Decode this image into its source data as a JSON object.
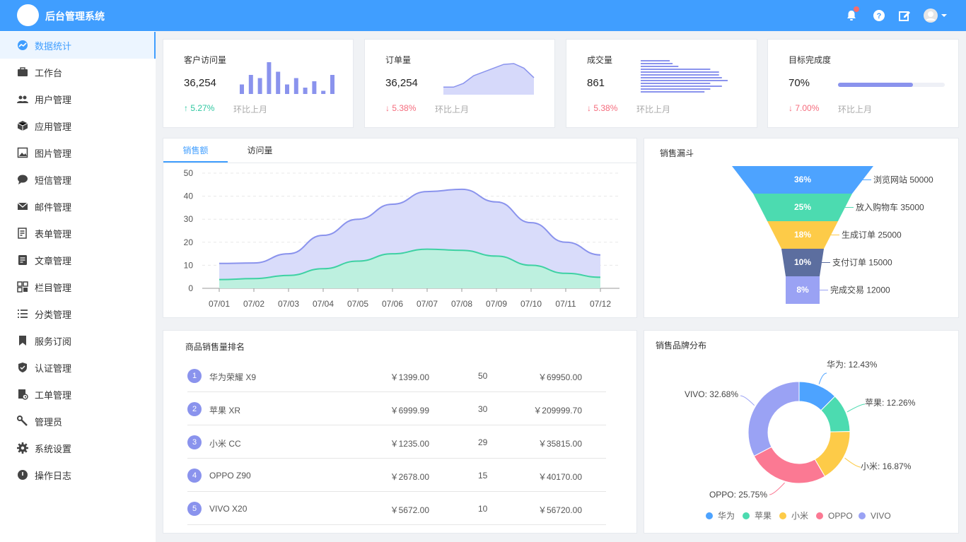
{
  "header": {
    "title": "后台管理系统"
  },
  "sidebar": {
    "items": [
      {
        "label": "数据统计",
        "icon": "dashboard-icon",
        "active": true
      },
      {
        "label": "工作台",
        "icon": "briefcase-icon"
      },
      {
        "label": "用户管理",
        "icon": "users-icon"
      },
      {
        "label": "应用管理",
        "icon": "cube-icon"
      },
      {
        "label": "图片管理",
        "icon": "image-icon"
      },
      {
        "label": "短信管理",
        "icon": "chat-icon"
      },
      {
        "label": "邮件管理",
        "icon": "mail-icon"
      },
      {
        "label": "表单管理",
        "icon": "form-icon"
      },
      {
        "label": "文章管理",
        "icon": "article-icon"
      },
      {
        "label": "栏目管理",
        "icon": "grid-icon"
      },
      {
        "label": "分类管理",
        "icon": "list-icon"
      },
      {
        "label": "服务订阅",
        "icon": "bookmark-icon"
      },
      {
        "label": "认证管理",
        "icon": "shield-icon"
      },
      {
        "label": "工单管理",
        "icon": "ticket-icon"
      },
      {
        "label": "管理员",
        "icon": "wrench-icon"
      },
      {
        "label": "系统设置",
        "icon": "gear-icon"
      },
      {
        "label": "操作日志",
        "icon": "log-icon"
      }
    ]
  },
  "kpis": [
    {
      "label": "客户访问量",
      "value": "36,254",
      "trend": "↑ 5.27%",
      "dir": "up",
      "compare": "环比上月"
    },
    {
      "label": "订单量",
      "value": "36,254",
      "trend": "↓ 5.38%",
      "dir": "down",
      "compare": "环比上月"
    },
    {
      "label": "成交量",
      "value": "861",
      "trend": "↓ 5.38%",
      "dir": "down",
      "compare": "环比上月"
    },
    {
      "label": "目标完成度",
      "value": "70%",
      "trend": "↓ 7.00%",
      "dir": "down",
      "compare": "环比上月",
      "progress": 0.7
    }
  ],
  "sales_tabs": [
    "销售额",
    "访问量"
  ],
  "funnel_title": "销售漏斗",
  "ranking": {
    "title": "商品销售量排名",
    "rows": [
      {
        "rank": "1",
        "name": "华为荣耀 X9",
        "price": "￥1399.00",
        "qty": "50",
        "total": "￥69950.00"
      },
      {
        "rank": "2",
        "name": "苹果 XR",
        "price": "￥6999.99",
        "qty": "30",
        "total": "￥209999.70"
      },
      {
        "rank": "3",
        "name": "小米 CC",
        "price": "￥1235.00",
        "qty": "29",
        "total": "￥35815.00"
      },
      {
        "rank": "4",
        "name": "OPPO Z90",
        "price": "￥2678.00",
        "qty": "15",
        "total": "￥40170.00"
      },
      {
        "rank": "5",
        "name": "VIVO X20",
        "price": "￥5672.00",
        "qty": "10",
        "total": "￥56720.00"
      }
    ]
  },
  "brand_title": "销售品牌分布",
  "chart_data": [
    {
      "type": "bar",
      "name": "visits-sparkline",
      "values": [
        3,
        6,
        5,
        10,
        7,
        3,
        5,
        2,
        4,
        1,
        6
      ]
    },
    {
      "type": "area",
      "name": "orders-sparkline",
      "values": [
        2,
        2,
        3,
        5,
        6,
        7,
        8,
        8.2,
        7,
        4.5
      ]
    },
    {
      "type": "bar",
      "name": "deals-sparkline",
      "orientation": "horizontal",
      "values": [
        5,
        5.5,
        6.5,
        12,
        13.5,
        13.5,
        14,
        15,
        12,
        14,
        12,
        11
      ]
    },
    {
      "type": "area",
      "name": "sales-area",
      "categories": [
        "07/01",
        "07/02",
        "07/03",
        "07/04",
        "07/05",
        "07/06",
        "07/07",
        "07/08",
        "07/09",
        "07/10",
        "07/11",
        "07/12"
      ],
      "series": [
        {
          "values": [
            10.8,
            11,
            15,
            23,
            30,
            36.5,
            42,
            43,
            37.5,
            28.5,
            20,
            14.5
          ],
          "color": "#8a93ed"
        },
        {
          "values": [
            3.8,
            4.2,
            5.6,
            8.5,
            11.8,
            15,
            17,
            16.5,
            14,
            10,
            6.5,
            4.8
          ],
          "color": "#3ed1a3"
        }
      ],
      "ylim": [
        0,
        50
      ],
      "yticks": [
        "50",
        "40",
        "30",
        "20",
        "10",
        "0"
      ],
      "grid": true
    },
    {
      "type": "funnel",
      "name": "sales-funnel",
      "stages": [
        {
          "pct": "36%",
          "label": "浏览网站 50000",
          "value": 50000,
          "color": "#4da3ff"
        },
        {
          "pct": "25%",
          "label": "放入购物车 35000",
          "value": 35000,
          "color": "#4cdbb0"
        },
        {
          "pct": "18%",
          "label": "生成订单 25000",
          "value": 25000,
          "color": "#fdcb48"
        },
        {
          "pct": "10%",
          "label": "支付订单 15000",
          "value": 15000,
          "color": "#5c6e9f"
        },
        {
          "pct": "8%",
          "label": "完成交易 12000",
          "value": 12000,
          "color": "#9aa2f4"
        }
      ]
    },
    {
      "type": "pie",
      "name": "brand-donut",
      "slices": [
        {
          "name": "华为",
          "label": "华为: 12.43%",
          "value": 12.43,
          "color": "#4da3ff"
        },
        {
          "name": "苹果",
          "label": "苹果: 12.26%",
          "value": 12.26,
          "color": "#4cdbb0"
        },
        {
          "name": "小米",
          "label": "小米: 16.87%",
          "value": 16.87,
          "color": "#fdcb48"
        },
        {
          "name": "OPPO",
          "label": "OPPO: 25.75%",
          "value": 25.75,
          "color": "#fb7993"
        },
        {
          "name": "VIVO",
          "label": "VIVO: 32.68%",
          "value": 32.68,
          "color": "#9aa2f4"
        }
      ],
      "legend": "bottom"
    }
  ]
}
